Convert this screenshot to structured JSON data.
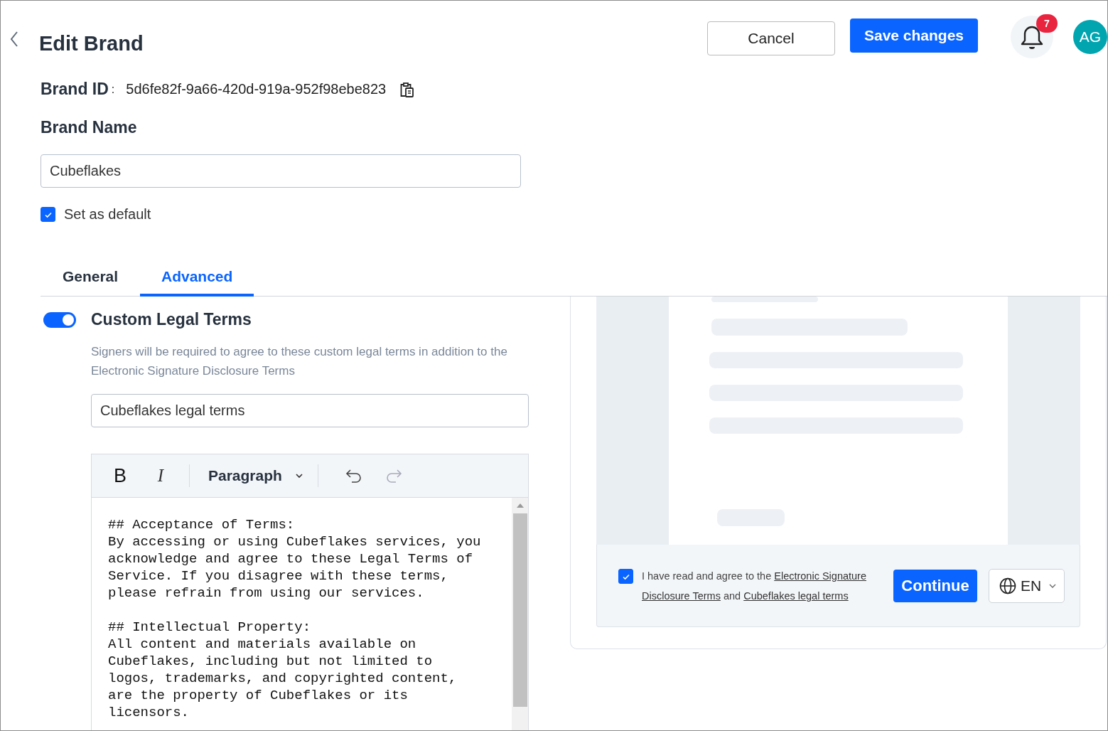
{
  "header": {
    "title": "Edit Brand",
    "cancel": "Cancel",
    "save": "Save changes",
    "notifications": "7",
    "avatar": "AG"
  },
  "brand_id": {
    "label": "Brand ID",
    "separator": ":",
    "value": "5d6fe82f-9a66-420d-919a-952f98ebe823"
  },
  "brand_name": {
    "label": "Brand Name",
    "value": "Cubeflakes"
  },
  "set_default": {
    "label": "Set as default",
    "checked": true
  },
  "tabs": [
    {
      "label": "General",
      "selected": false
    },
    {
      "label": "Advanced",
      "selected": true
    }
  ],
  "custom_terms": {
    "title": "Custom Legal Terms",
    "on": true,
    "description": "Signers will be required to agree to these custom legal terms in addition to the Electronic Signature Disclosure Terms",
    "name_value": "Cubeflakes legal terms",
    "toolbar": {
      "bold": "B",
      "italic": "I",
      "block_format": "Paragraph"
    },
    "paragraphs": [
      {
        "heading": "## Acceptance of Terms:",
        "body": "By accessing or using Cubeflakes services, you acknowledge and agree to these Legal Terms of Service. If you disagree with these terms, please refrain from using our services."
      },
      {
        "heading": "## Intellectual Property:",
        "body": "All content and materials available on Cubeflakes, including but not limited to logos, trademarks, and copyrighted content, are the property of Cubeflakes or its licensors."
      }
    ]
  },
  "preview": {
    "agree_checked": true,
    "agree_parts": [
      {
        "kind": "text",
        "text": "I have read and agree to the"
      },
      {
        "kind": "link",
        "text": "Electronic Signature"
      },
      {
        "kind": "link",
        "text": "Disclosure Terms"
      },
      {
        "kind": "text",
        "text": "and"
      },
      {
        "kind": "link",
        "text": "Cubeflakes legal terms"
      }
    ],
    "continue": "Continue",
    "language": "EN"
  }
}
